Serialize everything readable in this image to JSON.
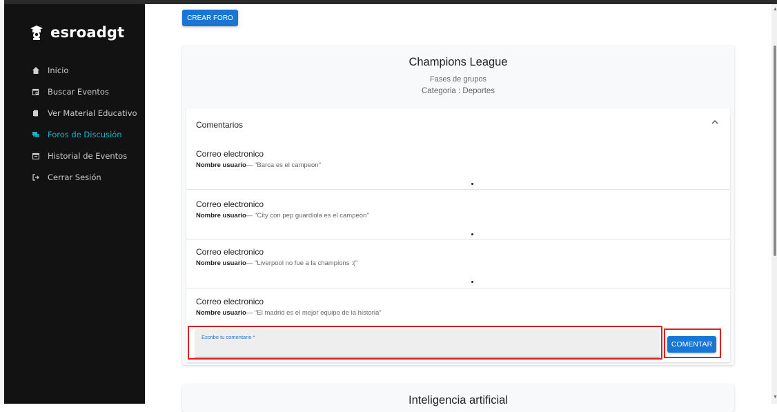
{
  "app": {
    "brand": "esroadgt"
  },
  "sidebar": {
    "items": [
      {
        "label": "Inicio",
        "icon": "home-icon"
      },
      {
        "label": "Buscar Eventos",
        "icon": "calendar-search-icon"
      },
      {
        "label": "Ver Material Educativo",
        "icon": "book-icon"
      },
      {
        "label": "Foros de Discusión",
        "icon": "forum-icon",
        "active": true
      },
      {
        "label": "Historial de Eventos",
        "icon": "calendar-icon"
      },
      {
        "label": "Cerrar Sesión",
        "icon": "logout-icon"
      }
    ]
  },
  "toolbar": {
    "create_label": "CREAR FORO"
  },
  "forum": {
    "title": "Champions League",
    "subtitle": "Fases de grupos",
    "category": "Categoria : Deportes",
    "panel_title": "Comentarios",
    "comments": [
      {
        "email": "Correo electronico",
        "user": "Nombre usuario",
        "text": "— \"Barca es el campeon\""
      },
      {
        "email": "Correo electronico",
        "user": "Nombre usuario",
        "text": "— \"City con pep guardiola es el campeon\""
      },
      {
        "email": "Correo electronico",
        "user": "Nombre usuario",
        "text": "— \"Liverpool no fue a la champions :(\""
      },
      {
        "email": "Correo electronico",
        "user": "Nombre usuario",
        "text": "— \"El madrid es el mejor equipo de la historia\""
      }
    ],
    "input_label": "Escribe tu comentario *",
    "input_value": "",
    "submit_label": "COMENTAR"
  },
  "next_forum": {
    "title": "Inteligencia artificial"
  },
  "colors": {
    "accent": "#1976d2",
    "active_nav": "#19b5c7",
    "highlight": "#e0201f",
    "sidebar_bg": "#121212"
  }
}
